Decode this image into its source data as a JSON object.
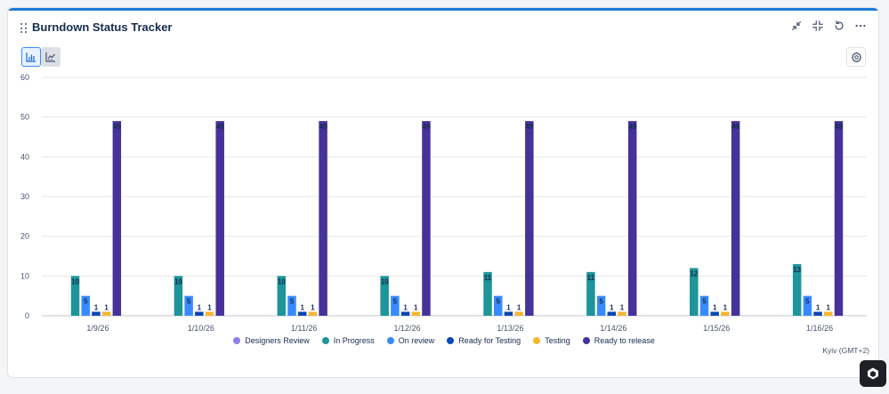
{
  "widget": {
    "title": "Burndown Status Tracker",
    "timezone": "Kyiv (GMT+2)",
    "accent": "#1e7bd6",
    "header_actions": [
      "minimize-icon",
      "collapse-icon",
      "refresh-icon",
      "more-icon"
    ],
    "view_modes": [
      "bar-chart-icon",
      "line-chart-icon"
    ],
    "active_view": "bar-chart-icon"
  },
  "chart_data": {
    "type": "bar",
    "title": "",
    "xlabel": "",
    "ylabel": "",
    "ylim": [
      0,
      60
    ],
    "yticks": [
      0,
      10,
      20,
      30,
      40,
      50,
      60
    ],
    "grid": true,
    "legend_position": "bottom",
    "categories": [
      "1/9/26",
      "1/10/26",
      "1/11/26",
      "1/12/26",
      "1/13/26",
      "1/14/26",
      "1/15/26",
      "1/16/26"
    ],
    "series": [
      {
        "name": "Designers Review",
        "color": "#8f7ee7",
        "values": [
          0,
          0,
          0,
          0,
          0,
          0,
          0,
          0
        ]
      },
      {
        "name": "In Progress",
        "color": "#1d959a",
        "values": [
          10,
          10,
          10,
          10,
          11,
          11,
          12,
          13
        ]
      },
      {
        "name": "On review",
        "color": "#388bff",
        "values": [
          5,
          5,
          5,
          5,
          5,
          5,
          5,
          5
        ]
      },
      {
        "name": "Ready for Testing",
        "color": "#0c48b4",
        "values": [
          1,
          1,
          1,
          1,
          1,
          1,
          1,
          1
        ]
      },
      {
        "name": "Testing",
        "color": "#f5b731",
        "values": [
          1,
          1,
          1,
          1,
          1,
          1,
          1,
          1
        ]
      },
      {
        "name": "Ready to release",
        "color": "#46329a",
        "values": [
          49,
          49,
          49,
          49,
          49,
          49,
          49,
          49
        ]
      }
    ]
  }
}
